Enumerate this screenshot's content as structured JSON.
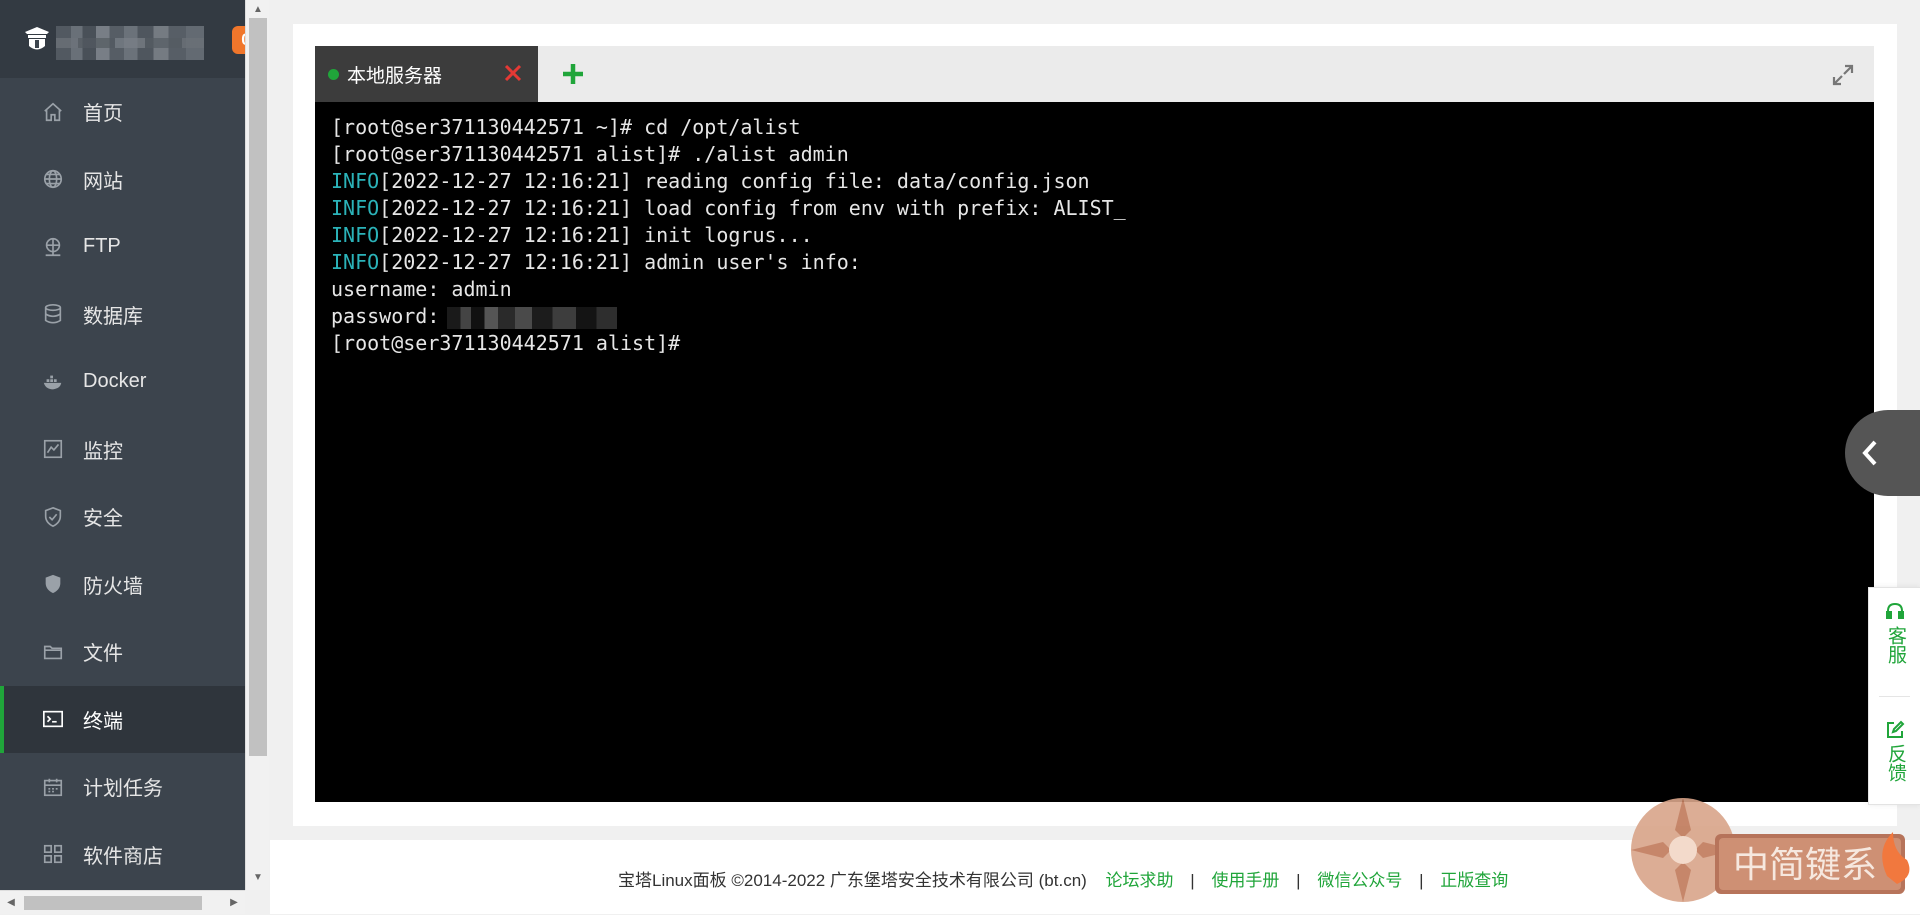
{
  "sidebar": {
    "notification_count": "0",
    "items": [
      {
        "label": "首页",
        "icon": "home-icon"
      },
      {
        "label": "网站",
        "icon": "globe-icon"
      },
      {
        "label": "FTP",
        "icon": "ftp-icon"
      },
      {
        "label": "数据库",
        "icon": "database-icon"
      },
      {
        "label": "Docker",
        "icon": "docker-icon"
      },
      {
        "label": "监控",
        "icon": "monitor-icon"
      },
      {
        "label": "安全",
        "icon": "shield-icon"
      },
      {
        "label": "防火墙",
        "icon": "firewall-icon"
      },
      {
        "label": "文件",
        "icon": "folder-icon"
      },
      {
        "label": "终端",
        "icon": "terminal-icon",
        "active": true
      },
      {
        "label": "计划任务",
        "icon": "calendar-icon"
      },
      {
        "label": "软件商店",
        "icon": "apps-icon"
      }
    ]
  },
  "terminal": {
    "tab_label": "本地服务器",
    "tab_status_color": "#20a53a",
    "lines": [
      {
        "prefix": "",
        "text": "[root@ser371130442571 ~]# cd /opt/alist"
      },
      {
        "prefix": "",
        "text": "[root@ser371130442571 alist]# ./alist admin"
      },
      {
        "prefix": "INFO",
        "text": "[2022-12-27 12:16:21] reading config file: data/config.json"
      },
      {
        "prefix": "INFO",
        "text": "[2022-12-27 12:16:21] load config from env with prefix: ALIST_"
      },
      {
        "prefix": "INFO",
        "text": "[2022-12-27 12:16:21] init logrus..."
      },
      {
        "prefix": "INFO",
        "text": "[2022-12-27 12:16:21] admin user's info:"
      },
      {
        "prefix": "",
        "text": "username: admin"
      },
      {
        "prefix": "",
        "text": "password:"
      },
      {
        "prefix": "",
        "text": "[root@ser371130442571 alist]#"
      }
    ]
  },
  "side_panel": {
    "support_label": "客服",
    "feedback_label": "反馈"
  },
  "footer": {
    "copyright": "宝塔Linux面板 ©2014-2022 广东堡塔安全技术有限公司 (bt.cn)",
    "links": [
      "论坛求助",
      "使用手册",
      "微信公众号",
      "正版查询"
    ],
    "separator": "|"
  },
  "watermark": {
    "text": "中简键系"
  },
  "colors": {
    "accent": "#20a53a",
    "sidebar_bg": "#3c444d",
    "badge": "#f0762b",
    "info": "#2bb3b9"
  }
}
